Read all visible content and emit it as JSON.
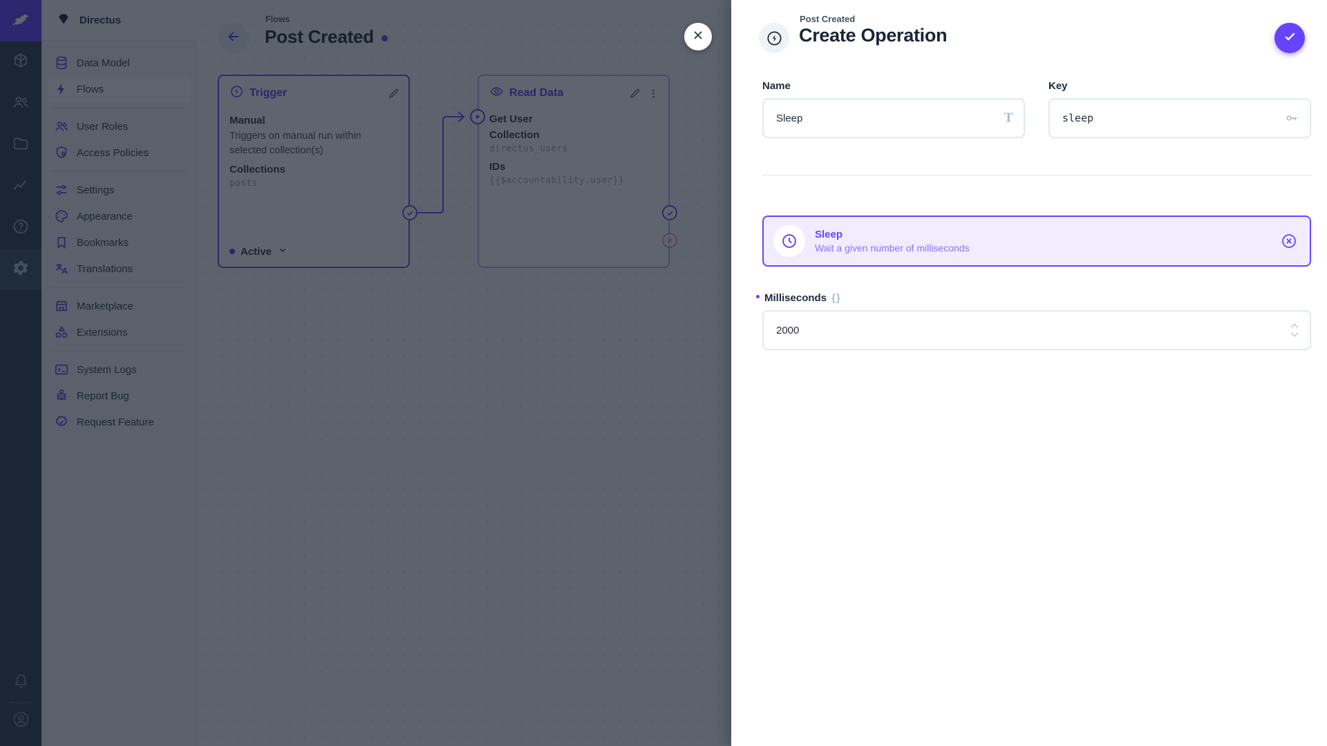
{
  "app": {
    "project_name": "Directus"
  },
  "colors": {
    "accent": "#6644ff",
    "danger": "#e35169",
    "foreground": "#172940",
    "subdued": "#a2b5cd",
    "panel_border": "#6a50f2"
  },
  "module_bar": {
    "logo_icon": "directus-rabbit-icon",
    "modules": [
      {
        "icon": "cube-icon"
      },
      {
        "icon": "people-icon"
      },
      {
        "icon": "folder-icon"
      },
      {
        "icon": "insights-icon"
      },
      {
        "icon": "help-icon"
      },
      {
        "icon": "settings-gear-icon",
        "active": true
      }
    ],
    "bottom_icons": [
      "bell-icon",
      "user-avatar-icon"
    ]
  },
  "sidebar": {
    "groups": [
      [
        {
          "label": "Data Model",
          "icon": "database-icon"
        },
        {
          "label": "Flows",
          "icon": "bolt-icon",
          "active": true
        }
      ],
      [
        {
          "label": "User Roles",
          "icon": "people-icon"
        },
        {
          "label": "Access Policies",
          "icon": "shield-lock-icon"
        }
      ],
      [
        {
          "label": "Settings",
          "icon": "tune-icon"
        },
        {
          "label": "Appearance",
          "icon": "palette-icon"
        },
        {
          "label": "Bookmarks",
          "icon": "bookmark-icon"
        },
        {
          "label": "Translations",
          "icon": "translate-icon"
        }
      ],
      [
        {
          "label": "Marketplace",
          "icon": "storefront-icon"
        },
        {
          "label": "Extensions",
          "icon": "shapes-icon"
        }
      ],
      [
        {
          "label": "System Logs",
          "icon": "terminal-icon"
        },
        {
          "label": "Report Bug",
          "icon": "bug-icon"
        },
        {
          "label": "Request Feature",
          "icon": "seal-check-icon"
        }
      ]
    ]
  },
  "flow": {
    "breadcrumb": "Flows",
    "title": "Post Created",
    "trigger": {
      "header": "Trigger",
      "type": "Manual",
      "description": "Triggers on manual run within selected collection(s)",
      "field_label": "Collections",
      "field_value": "posts",
      "status": "Active"
    },
    "read_data": {
      "header": "Read Data",
      "name": "Get User",
      "collection_label": "Collection",
      "collection_value": "directus_users",
      "ids_label": "IDs",
      "ids_value": "{{$accountability.user}}"
    }
  },
  "drawer": {
    "breadcrumb": "Post Created",
    "title": "Create Operation",
    "name_field": {
      "label": "Name",
      "value": "Sleep",
      "suffix_glyph": "T"
    },
    "key_field": {
      "label": "Key",
      "value": "sleep"
    },
    "operation": {
      "name": "Sleep",
      "description": "Wait a given number of milliseconds"
    },
    "milliseconds_field": {
      "label": "Milliseconds",
      "raw_glyph": "{}",
      "value": "2000"
    }
  }
}
